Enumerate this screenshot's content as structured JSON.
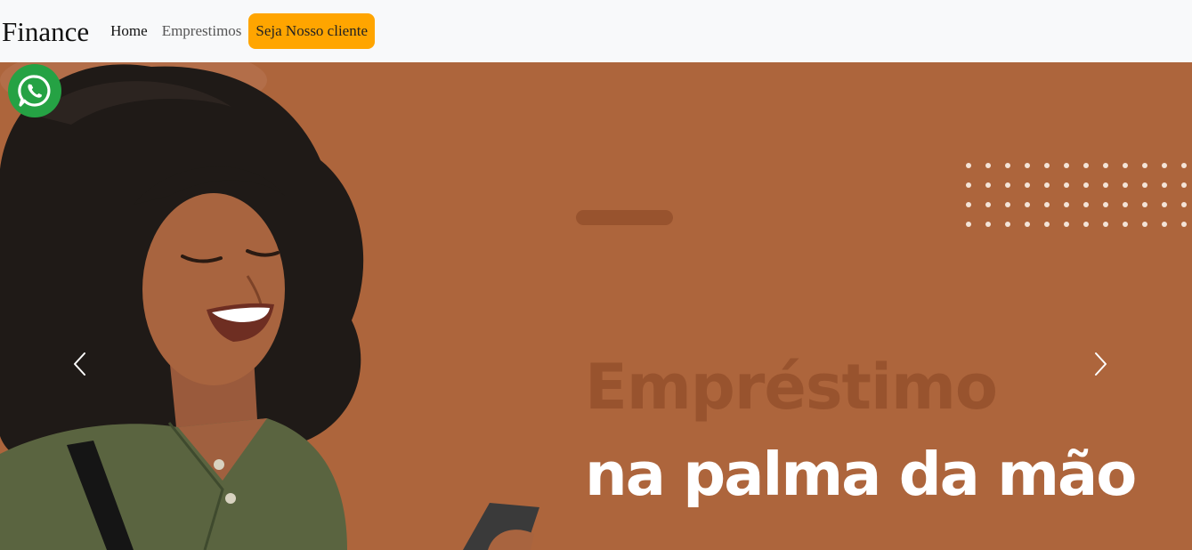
{
  "navbar": {
    "brand": "Finance",
    "links": [
      {
        "label": "Home"
      },
      {
        "label": "Emprestimos"
      }
    ],
    "cta_label": "Seja Nosso cliente"
  },
  "hero": {
    "headline_line1": "Empréstimo",
    "headline_line2": "na palma da mão",
    "background_color": "#ad653c",
    "accent_color": "#98532e"
  },
  "carousel": {
    "prev_icon": "chevron-left-icon",
    "next_icon": "chevron-right-icon"
  },
  "floating": {
    "whatsapp_icon": "whatsapp-icon"
  },
  "colors": {
    "cta": "#ffa500",
    "whatsapp": "#25a244"
  }
}
